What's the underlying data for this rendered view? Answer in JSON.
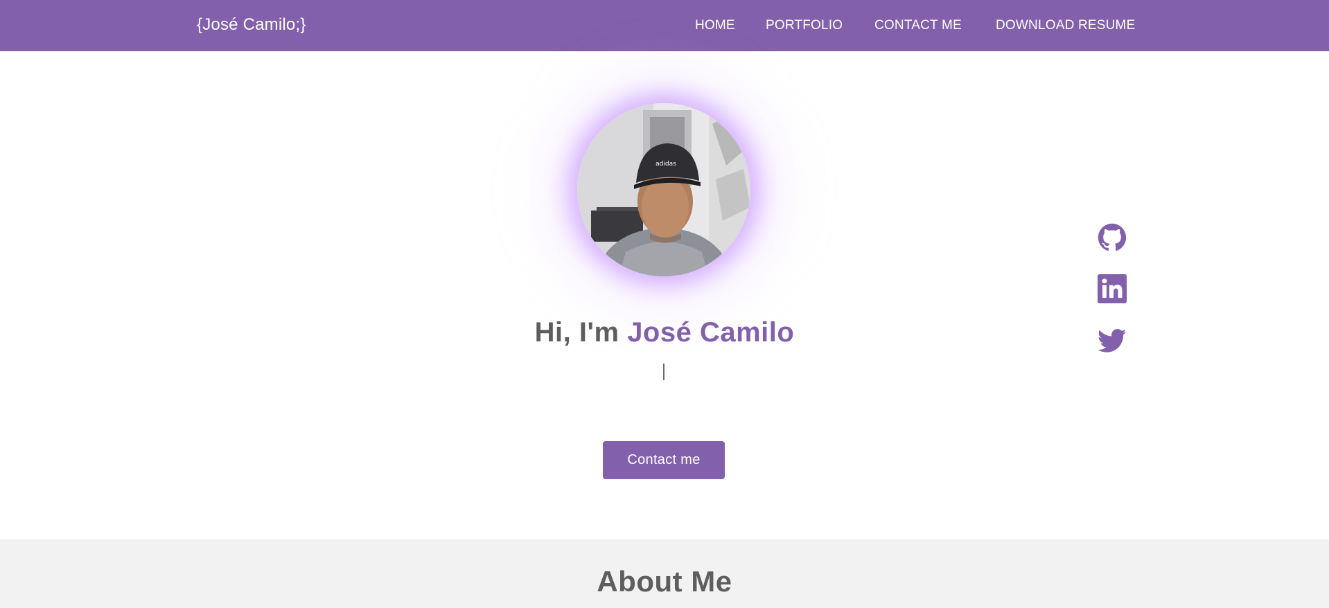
{
  "header": {
    "brand": "{José Camilo;}",
    "nav": [
      {
        "label": "HOME"
      },
      {
        "label": "PORTFOLIO"
      },
      {
        "label": "CONTACT ME"
      },
      {
        "label": "DOWNLOAD RESUME"
      }
    ]
  },
  "hero": {
    "greeting_prefix": "Hi, I'm",
    "name": "José Camilo",
    "typed_text": "",
    "button_label": "Contact me"
  },
  "social": [
    {
      "icon": "github-icon"
    },
    {
      "icon": "linkedin-icon"
    },
    {
      "icon": "twitter-icon"
    }
  ],
  "about": {
    "title": "About Me"
  },
  "colors": {
    "accent": "#8260ab",
    "text": "#5e5e5e",
    "section_bg": "#f2f2f2",
    "glow": "#c08aff"
  }
}
